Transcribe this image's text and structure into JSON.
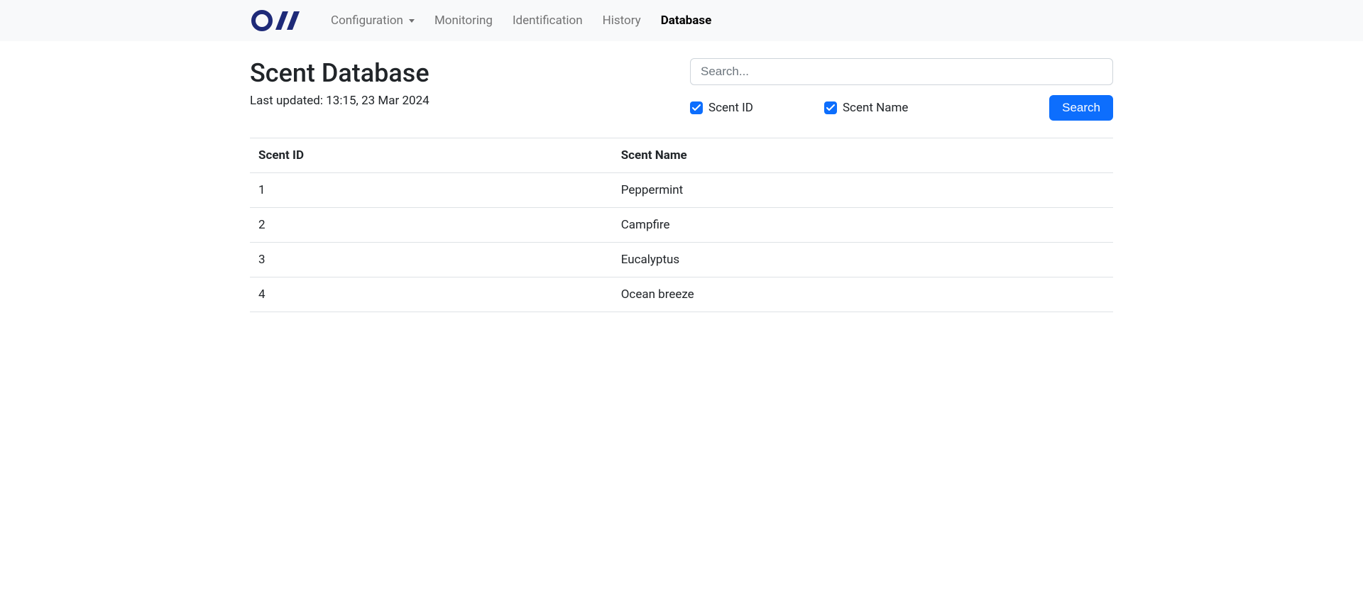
{
  "nav": {
    "items": [
      {
        "label": "Configuration",
        "dropdown": true
      },
      {
        "label": "Monitoring"
      },
      {
        "label": "Identification"
      },
      {
        "label": "History"
      },
      {
        "label": "Database",
        "active": true
      }
    ]
  },
  "page": {
    "title": "Scent Database",
    "last_updated": "Last updated: 13:15, 23 Mar 2024"
  },
  "search": {
    "placeholder": "Search...",
    "checkbox_id_label": "Scent ID",
    "checkbox_name_label": "Scent Name",
    "button_label": "Search"
  },
  "table": {
    "headers": [
      "Scent ID",
      "Scent Name"
    ],
    "rows": [
      {
        "id": "1",
        "name": "Peppermint"
      },
      {
        "id": "2",
        "name": "Campfire"
      },
      {
        "id": "3",
        "name": "Eucalyptus"
      },
      {
        "id": "4",
        "name": "Ocean breeze"
      }
    ]
  }
}
